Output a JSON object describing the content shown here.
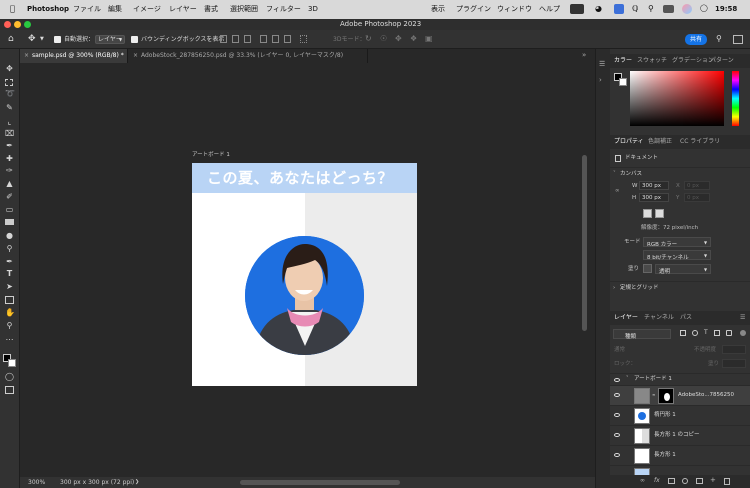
{
  "menubar": {
    "app": "Photoshop",
    "items": [
      "ファイル",
      "編集",
      "イメージ",
      "レイヤー",
      "書式",
      "選択範囲",
      "フィルター",
      "3D",
      "表示",
      "プラグイン",
      "ウィンドウ",
      "ヘルプ"
    ],
    "time": "19:58"
  },
  "titlebar": {
    "title": "Adobe Photoshop 2023"
  },
  "options": {
    "auto_select_label": "自動選択：",
    "auto_select_value": "レイヤー",
    "bounding_box_label": "バウンディングボックスを表示",
    "mode_3d": "3Dモード：",
    "share_label": "共有"
  },
  "tabs": [
    {
      "label": "sample.psd @ 300% (RGB/8) *"
    },
    {
      "label": "AdobeStock_287856250.psd @ 33.3% (レイヤー 0, レイヤーマスク/8)"
    }
  ],
  "artboard": {
    "name": "アートボード 1",
    "headline": "この夏、あなたはどっち？",
    "colors": {
      "banner": "#b9d4f5",
      "circle": "#1e6fe0",
      "right_bg": "#ececec",
      "left_bg": "#ffffff"
    }
  },
  "status": {
    "zoom": "300%",
    "doc_info": "300 px x 300 px (72 ppi)"
  },
  "color_panel": {
    "tabs": [
      "カラー",
      "スウォッチ",
      "グラデーション",
      "パターン"
    ]
  },
  "properties": {
    "tabs": [
      "プロパティ",
      "色調補正",
      "CC ライブラリ"
    ],
    "doc_type": "ドキュメント",
    "canvas_section": "カンバス",
    "w_label": "W",
    "w_value": "300 px",
    "h_label": "H",
    "h_value": "300 px",
    "x_label": "X",
    "x_value": "0 px",
    "y_label": "Y",
    "y_value": "0 px",
    "resolution": "解像度：72 pixel/inch",
    "mode_label": "モード",
    "mode_value": "RGB カラー",
    "depth_value": "8 bit/チャンネル",
    "fill_label": "塗り",
    "fill_value": "透明",
    "rulers_section": "定規とグリッド"
  },
  "layers_panel": {
    "tabs": [
      "レイヤー",
      "チャンネル",
      "パス"
    ],
    "filter_type": "種類",
    "blend_mode": "通常",
    "opacity_label": "不透明度",
    "lock_label": "ロック：",
    "fill_label": "塗り",
    "artboard_layer": "アートボード 1",
    "layers": [
      "AdobeSto...7856250",
      "楕円形 1",
      "長方形 1 のコピー",
      "長方形 1"
    ]
  }
}
